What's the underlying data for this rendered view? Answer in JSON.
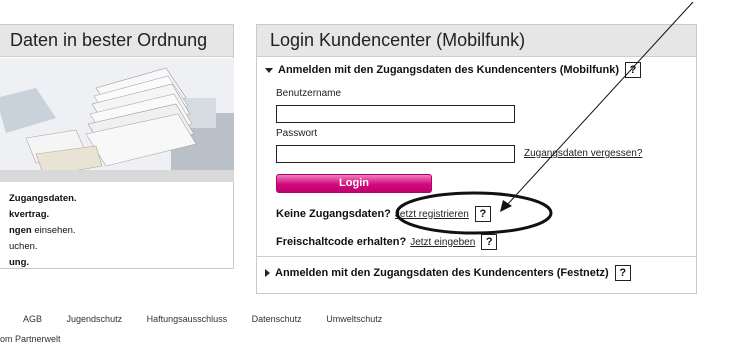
{
  "left_panel": {
    "title": "Daten in bester Ordnung",
    "list": [
      {
        "bold": "Zugangsdaten.",
        "text": ""
      },
      {
        "bold": "kvertrag.",
        "text": ""
      },
      {
        "bold": "ngen",
        "text": " einsehen."
      },
      {
        "bold": "",
        "text": "uchen."
      },
      {
        "bold": "ung.",
        "text": ""
      }
    ]
  },
  "login_panel": {
    "title": "Login Kundencenter (Mobilfunk)",
    "section_mobil": "Anmelden mit den Zugangsdaten des Kundencenters (Mobilfunk)",
    "help": "?",
    "username_label": "Benutzername",
    "password_label": "Passwort",
    "forgot_link": "Zugangsdaten vergessen?",
    "login_button": "Login",
    "register_text": "Keine Zugangsdaten?",
    "register_link": "Jetzt registrieren",
    "unlock_text": "Freischaltcode erhalten?",
    "unlock_link": "Jetzt eingeben",
    "section_festnetz": "Anmelden mit den Zugangsdaten des Kundencenters (Festnetz)"
  },
  "footer": {
    "links": [
      "AGB",
      "Jugendschutz",
      "Haftungsausschluss",
      "Datenschutz",
      "Umweltschutz"
    ],
    "line2": "om Partnerwelt"
  }
}
